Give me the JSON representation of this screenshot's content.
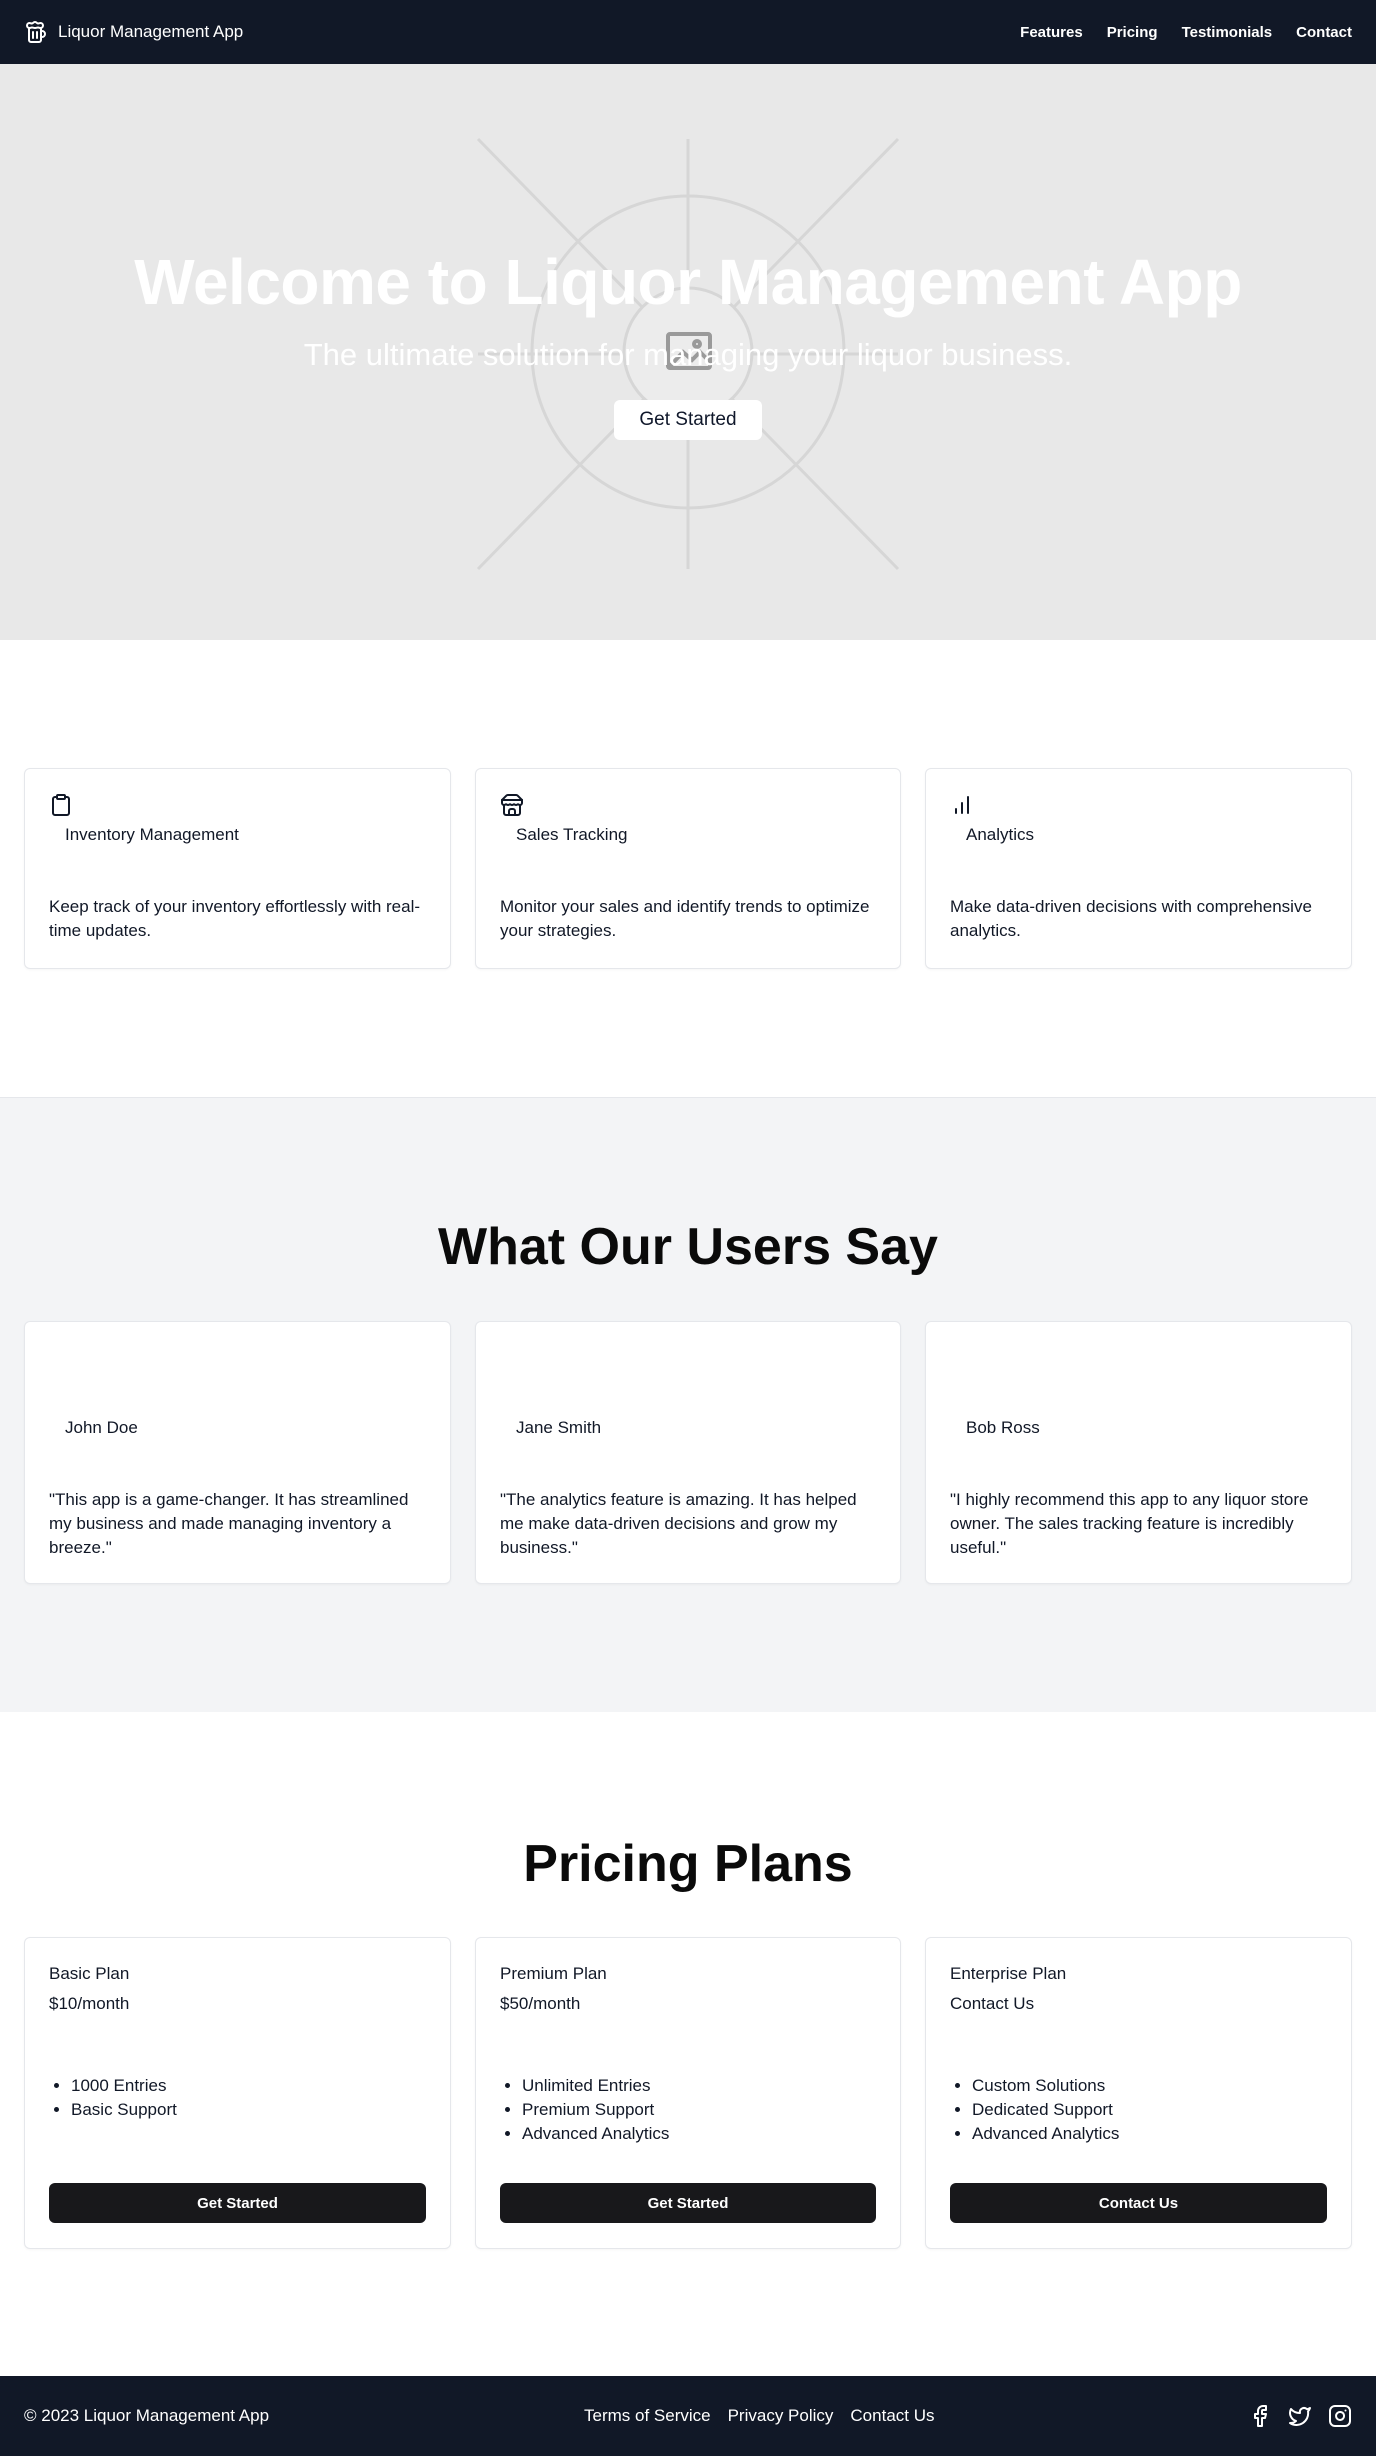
{
  "header": {
    "brand": "Liquor Management App",
    "nav": [
      "Features",
      "Pricing",
      "Testimonials",
      "Contact"
    ]
  },
  "hero": {
    "title": "Welcome to Liquor Management App",
    "subtitle": "The ultimate solution for managing your liquor business.",
    "cta": "Get Started"
  },
  "features": [
    {
      "icon": "clipboard-icon",
      "title": "Inventory Management",
      "text": "Keep track of your inventory effortlessly with real-time updates."
    },
    {
      "icon": "store-icon",
      "title": "Sales Tracking",
      "text": "Monitor your sales and identify trends to optimize your strategies."
    },
    {
      "icon": "bar-chart-icon",
      "title": "Analytics",
      "text": "Make data-driven decisions with comprehensive analytics."
    }
  ],
  "testimonials": {
    "title": "What Our Users Say",
    "items": [
      {
        "name": "John Doe",
        "quote": "\"This app is a game-changer. It has streamlined my business and made managing inventory a breeze.\""
      },
      {
        "name": "Jane Smith",
        "quote": "\"The analytics feature is amazing. It has helped me make data-driven decisions and grow my business.\""
      },
      {
        "name": "Bob Ross",
        "quote": "\"I highly recommend this app to any liquor store owner. The sales tracking feature is incredibly useful.\""
      }
    ]
  },
  "pricing": {
    "title": "Pricing Plans",
    "plans": [
      {
        "name": "Basic Plan",
        "price": "$10/month",
        "features": [
          "1000 Entries",
          "Basic Support"
        ],
        "cta": "Get Started"
      },
      {
        "name": "Premium Plan",
        "price": "$50/month",
        "features": [
          "Unlimited Entries",
          "Premium Support",
          "Advanced Analytics"
        ],
        "cta": "Get Started"
      },
      {
        "name": "Enterprise Plan",
        "price": "Contact Us",
        "features": [
          "Custom Solutions",
          "Dedicated Support",
          "Advanced Analytics"
        ],
        "cta": "Contact Us"
      }
    ]
  },
  "footer": {
    "copyright": "© 2023 Liquor Management App",
    "links": [
      "Terms of Service",
      "Privacy Policy",
      "Contact Us"
    ],
    "social": [
      "facebook-icon",
      "twitter-icon",
      "instagram-icon"
    ]
  },
  "colors": {
    "header_bg": "#111827",
    "hero_bg": "#e8e8e8",
    "section_gray": "#f3f4f6",
    "button_dark": "#18181b"
  }
}
